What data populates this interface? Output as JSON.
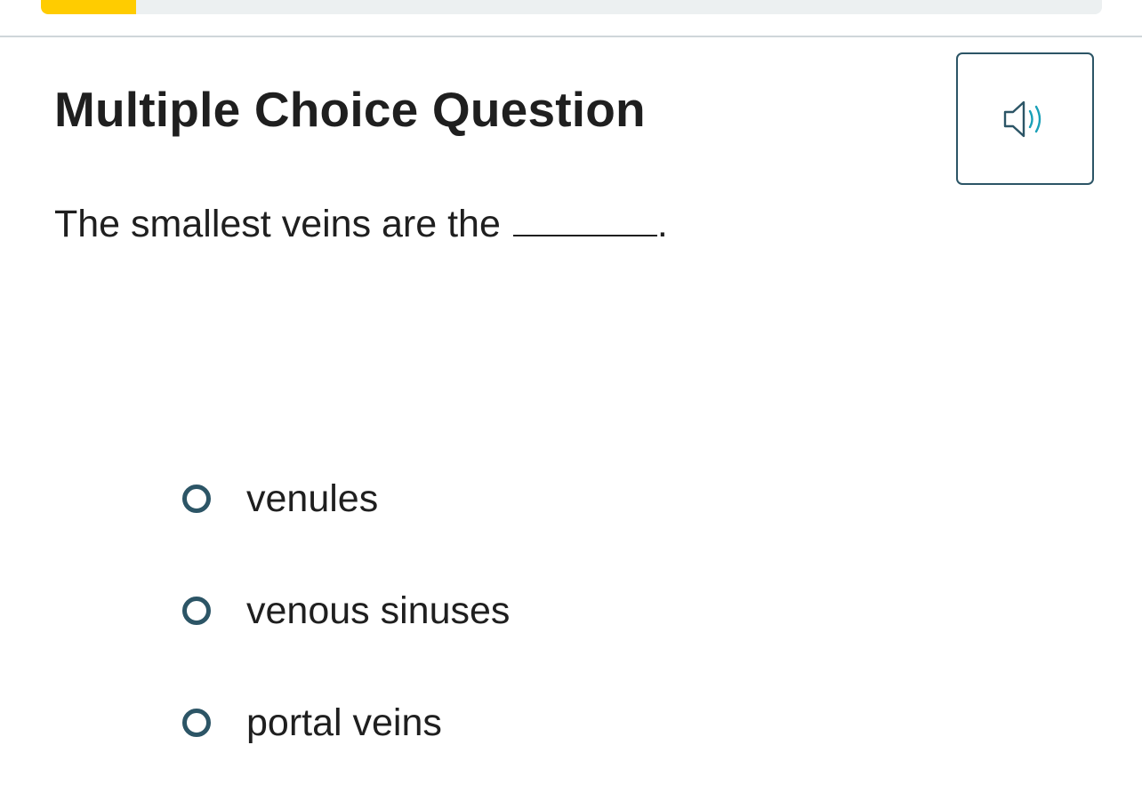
{
  "progress": {
    "fraction": 0.09
  },
  "header": {
    "question_type": "Multiple Choice Question",
    "audio_icon": "speaker-icon"
  },
  "question": {
    "prompt": "The smallest veins are the",
    "suffix": "."
  },
  "options": [
    {
      "label": "venules"
    },
    {
      "label": "venous sinuses"
    },
    {
      "label": "portal veins"
    }
  ],
  "colors": {
    "accent": "#ffcc00",
    "control": "#2c5566",
    "icon_accent": "#1aa0b8"
  }
}
